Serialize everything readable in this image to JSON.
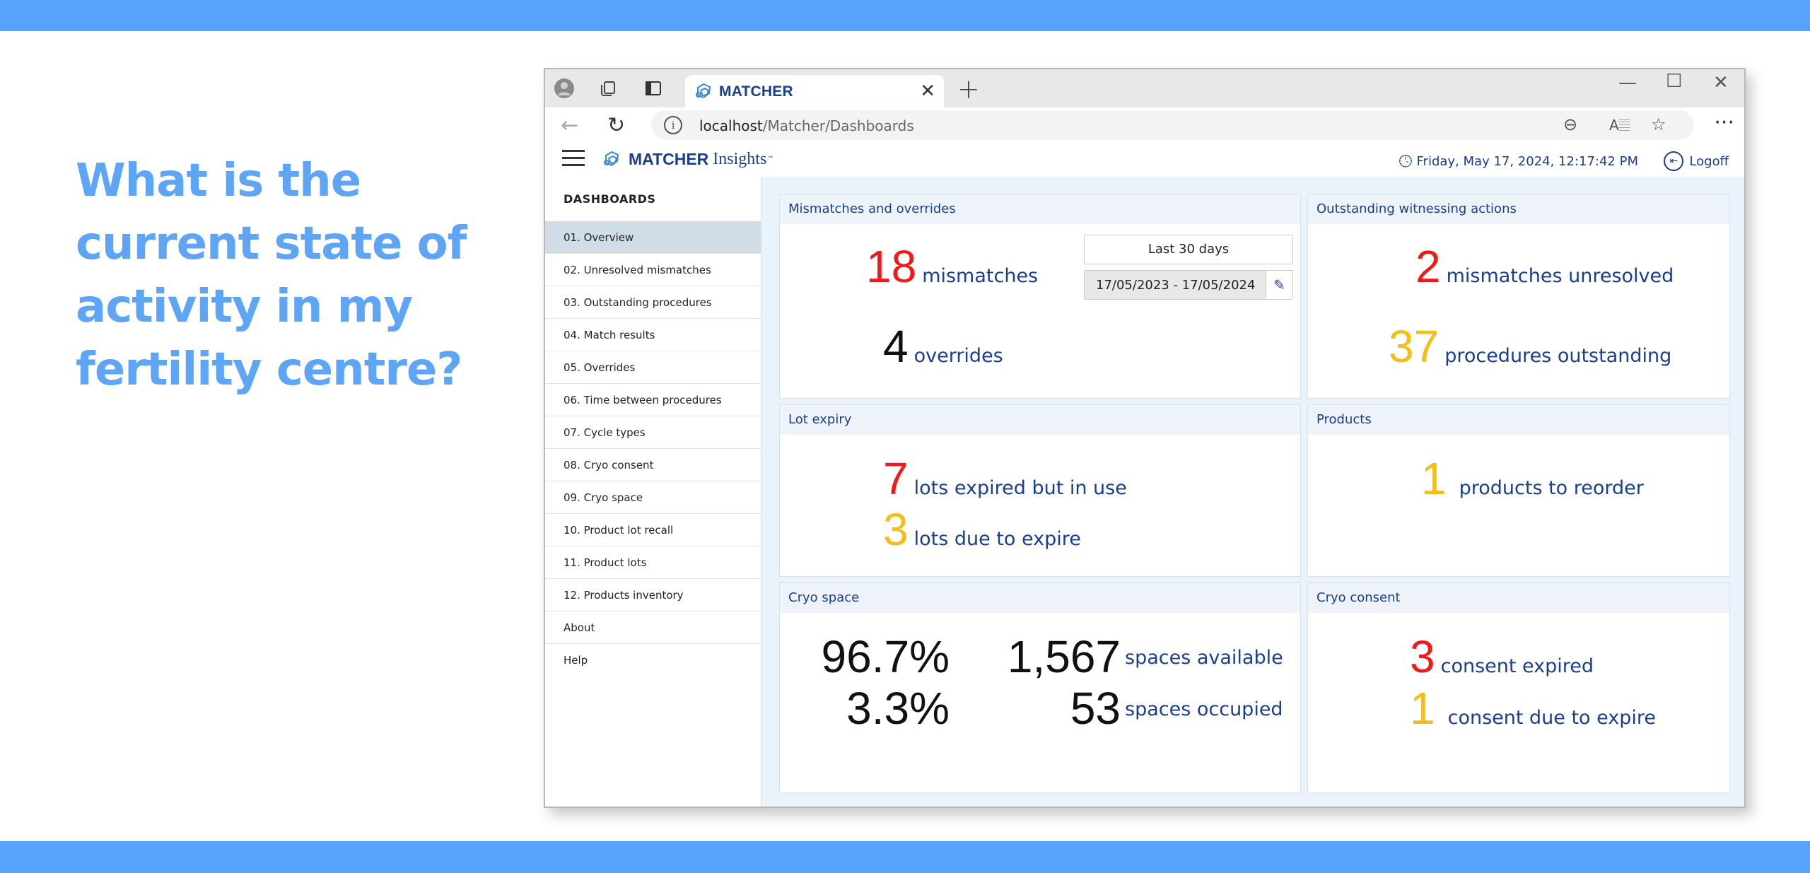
{
  "slide": {
    "question": "What is the current state of activity in my fertility centre?"
  },
  "browser": {
    "tab_title": "MATCHER",
    "url_host": "localhost",
    "url_path": "/Matcher/Dashboards"
  },
  "app": {
    "brand_name": "MATCHER",
    "brand_sub": "Insights",
    "brand_tm": "™",
    "datetime": "Friday, May 17, 2024, 12:17:42 PM",
    "logoff": "Logoff"
  },
  "sidebar": {
    "heading": "DASHBOARDS",
    "items": [
      {
        "label": "01. Overview"
      },
      {
        "label": "02. Unresolved mismatches"
      },
      {
        "label": "03. Outstanding procedures"
      },
      {
        "label": "04. Match results"
      },
      {
        "label": "05. Overrides"
      },
      {
        "label": "06. Time between procedures"
      },
      {
        "label": "07. Cycle types"
      },
      {
        "label": "08. Cryo consent"
      },
      {
        "label": "09. Cryo space"
      },
      {
        "label": "10. Product lot recall"
      },
      {
        "label": "11. Product lots"
      },
      {
        "label": "12. Products inventory"
      },
      {
        "label": "About"
      },
      {
        "label": "Help"
      }
    ]
  },
  "panels": {
    "mismatches": {
      "title": "Mismatches and overrides",
      "mismatches_count": "18",
      "mismatches_label": "mismatches",
      "overrides_count": "4",
      "overrides_label": "overrides",
      "range_button": "Last 30 days",
      "range_value": "17/05/2023 - 17/05/2024"
    },
    "witnessing": {
      "title": "Outstanding witnessing actions",
      "unresolved_count": "2",
      "unresolved_label": "mismatches unresolved",
      "outstanding_count": "37",
      "outstanding_label": "procedures outstanding"
    },
    "lot_expiry": {
      "title": "Lot expiry",
      "expired_count": "7",
      "expired_label": "lots expired but in use",
      "due_count": "3",
      "due_label": "lots due to expire"
    },
    "products": {
      "title": "Products",
      "reorder_count": "1",
      "reorder_label": "products to reorder"
    },
    "cryo_space": {
      "title": "Cryo space",
      "available_pct": "96.7%",
      "available_count": "1,567",
      "available_label": "spaces available",
      "occupied_pct": "3.3%",
      "occupied_count": "53",
      "occupied_label": "spaces occupied"
    },
    "cryo_consent": {
      "title": "Cryo consent",
      "expired_count": "3",
      "expired_label": "consent expired",
      "due_count": "1",
      "due_label": "consent due to expire"
    }
  },
  "colors": {
    "band": "#57a3fc",
    "question": "#5ea5f6",
    "brand": "#1b3f8f",
    "alert_red": "#ee1b1b",
    "warning_yellow": "#f6bd16"
  },
  "icons": {
    "profile": "profile-icon",
    "collections": "collections-icon",
    "tab_actions": "tab-actions-icon",
    "matcher_logo": "matcher-logo-icon",
    "close": "close-icon",
    "new_tab": "plus-icon",
    "back": "back-arrow-icon",
    "refresh": "refresh-icon",
    "info": "info-icon",
    "zoom_out": "zoom-out-icon",
    "read_aloud": "read-aloud-icon",
    "favorite": "star-icon",
    "more": "more-icon",
    "menu": "hamburger-icon",
    "history": "clock-icon",
    "logoff": "logoff-icon",
    "edit": "pencil-icon"
  }
}
